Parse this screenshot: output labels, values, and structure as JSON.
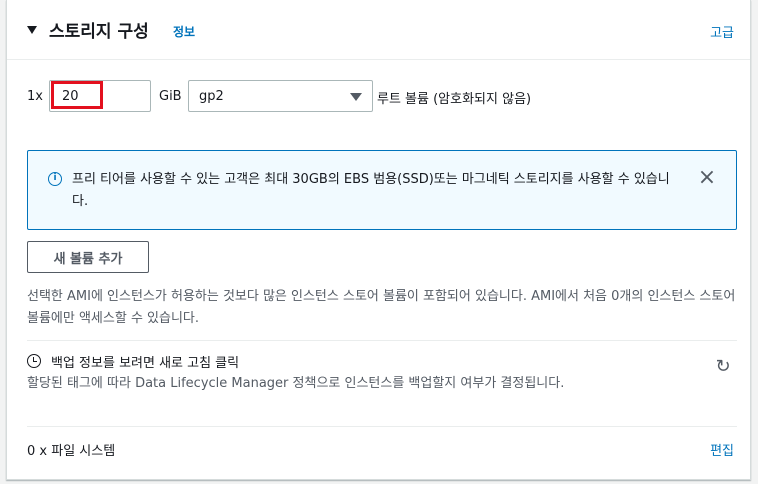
{
  "header": {
    "title": "스토리지 구성",
    "info_link": "정보",
    "advanced_link": "고급"
  },
  "volume": {
    "count_label": "1x",
    "size_value": "20",
    "size_unit": "GiB",
    "volume_type": "gp2",
    "root_label": "루트 볼륨  (암호화되지 않음)"
  },
  "alert": {
    "icon": "info-icon",
    "text": "프리 티어를 사용할 수 있는 고객은 최대 30GB의 EBS 범용(SSD)또는 마그네틱 스토리지를 사용할 수 있습니다.",
    "close_icon": "close-icon"
  },
  "add_volume_button": "새 볼륨 추가",
  "description": "선택한 AMI에 인스턴스가 허용하는 것보다 많은 인스턴스 스토어 볼륨이 포함되어 있습니다. AMI에서 처음 0개의 인스턴스 스토어 볼륨에만 액세스할 수 있습니다.",
  "backup": {
    "icon": "clock-icon",
    "title": "백업 정보를 보려면 새로 고침 클릭",
    "description": "할당된 태그에 따라 Data Lifecycle Manager 정책으로 인스턴스를 백업할지 여부가 결정됩니다.",
    "refresh_icon": "refresh-icon"
  },
  "file_system": {
    "label": "0 x 파일 시스템",
    "edit_link": "편집"
  },
  "colors": {
    "link": "#0073bb",
    "highlight": "#e3101e",
    "alert_bg": "#f1faff"
  }
}
